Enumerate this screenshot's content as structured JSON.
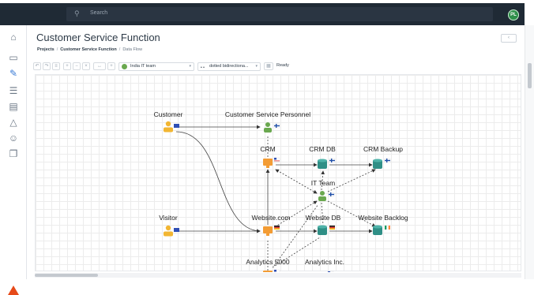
{
  "topbar": {
    "search_placeholder": "Search",
    "avatar_initials": "PL"
  },
  "page": {
    "title": "Customer Service Function",
    "breadcrumb": [
      "Projects",
      "Customer Service Function",
      "Data Flow"
    ]
  },
  "toolbar": {
    "team_select": "India IT team",
    "line_style_select": "dotted bidirectiona...",
    "status": "Ready"
  },
  "diagram": {
    "nodes": [
      {
        "id": "customer",
        "label": "Customer",
        "kind": "person-yellow",
        "flag": "eu"
      },
      {
        "id": "csp",
        "label": "Customer Service Personnel",
        "kind": "person-green",
        "flag": "fi"
      },
      {
        "id": "crm",
        "label": "CRM",
        "kind": "server-orange",
        "flag": "us"
      },
      {
        "id": "crmdb",
        "label": "CRM DB",
        "kind": "db-teal",
        "flag": "fi"
      },
      {
        "id": "crmbackup",
        "label": "CRM Backup",
        "kind": "db-teal",
        "flag": "fi"
      },
      {
        "id": "itteam",
        "label": "IT Team",
        "kind": "person-green",
        "flag": "fi"
      },
      {
        "id": "visitor",
        "label": "Visitor",
        "kind": "person-yellow",
        "flag": "eu"
      },
      {
        "id": "website",
        "label": "Website.com",
        "kind": "server-orange",
        "flag": "de"
      },
      {
        "id": "websitedb",
        "label": "Website DB",
        "kind": "db-teal",
        "flag": "de"
      },
      {
        "id": "websitebackup",
        "label": "Website Backlog",
        "kind": "db-teal",
        "flag": "ie"
      },
      {
        "id": "analytics5000",
        "label": "Analytics 5000",
        "kind": "server-orange",
        "flag": "us"
      },
      {
        "id": "analyticsinc",
        "label": "Analytics Inc.",
        "kind": "building",
        "flag": "us"
      }
    ]
  },
  "colors": {
    "topbar": "#1f2a35",
    "accent": "#3a7bd5",
    "person_yellow": "#f2b632",
    "person_green": "#6aa84f",
    "server_orange": "#f39c34",
    "db_teal": "#2f8f86",
    "logo": "#e64a19"
  }
}
